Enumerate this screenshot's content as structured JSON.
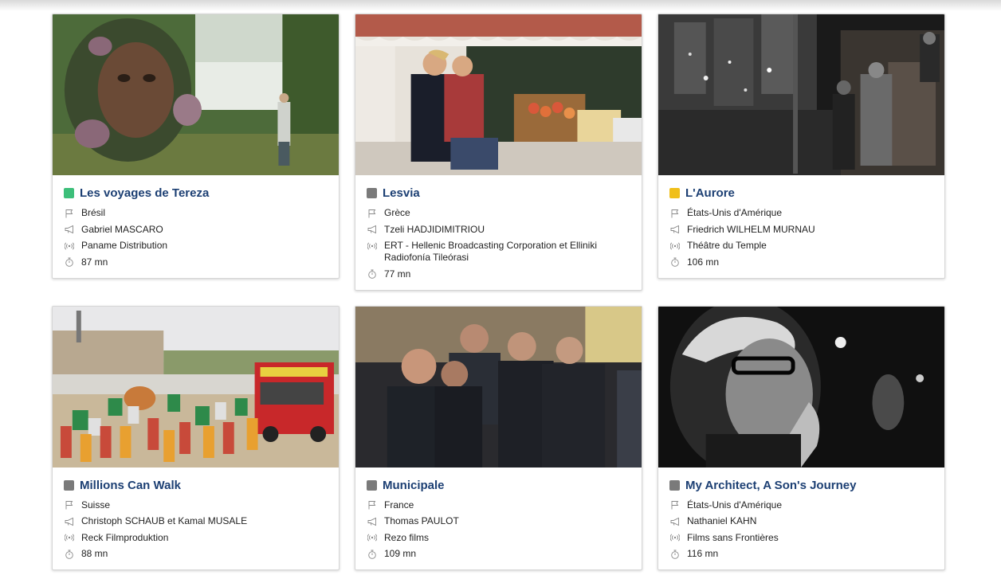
{
  "colors": {
    "title": "#1c3f73",
    "status_green": "#3dbf7a",
    "status_grey": "#7a7a7a",
    "status_yellow": "#f0bf1a"
  },
  "icons": {
    "country": "flag-icon",
    "director": "megaphone-icon",
    "distributor": "broadcast-icon",
    "duration": "stopwatch-icon"
  },
  "films": [
    {
      "title": "Les voyages de Tereza",
      "status_color": "#3dbf7a",
      "country": "Brésil",
      "director": "Gabriel MASCARO",
      "distributor": "Paname Distribution",
      "duration": "87 mn"
    },
    {
      "title": "Lesvia",
      "status_color": "#7a7a7a",
      "country": "Grèce",
      "director": "Tzeli HADJIDIMITRIOU",
      "distributor": "ERT - Hellenic Broadcasting Corporation et Elliniki Radiofonía Tileórasi",
      "duration": "77 mn"
    },
    {
      "title": "L'Aurore",
      "status_color": "#f0bf1a",
      "country": "États-Unis d'Amérique",
      "director": "Friedrich WILHELM MURNAU",
      "distributor": "Théâtre du Temple",
      "duration": "106 mn"
    },
    {
      "title": "Millions Can Walk",
      "status_color": "#7a7a7a",
      "country": "Suisse",
      "director": "Christoph SCHAUB et Kamal MUSALE",
      "distributor": "Reck Filmproduktion",
      "duration": "88 mn"
    },
    {
      "title": "Municipale",
      "status_color": "#7a7a7a",
      "country": "France",
      "director": "Thomas PAULOT",
      "distributor": "Rezo films",
      "duration": "109 mn"
    },
    {
      "title": "My Architect, A Son's Journey",
      "status_color": "#7a7a7a",
      "country": "États-Unis d'Amérique",
      "director": "Nathaniel KAHN",
      "distributor": "Films sans Frontières",
      "duration": "116 mn"
    }
  ]
}
